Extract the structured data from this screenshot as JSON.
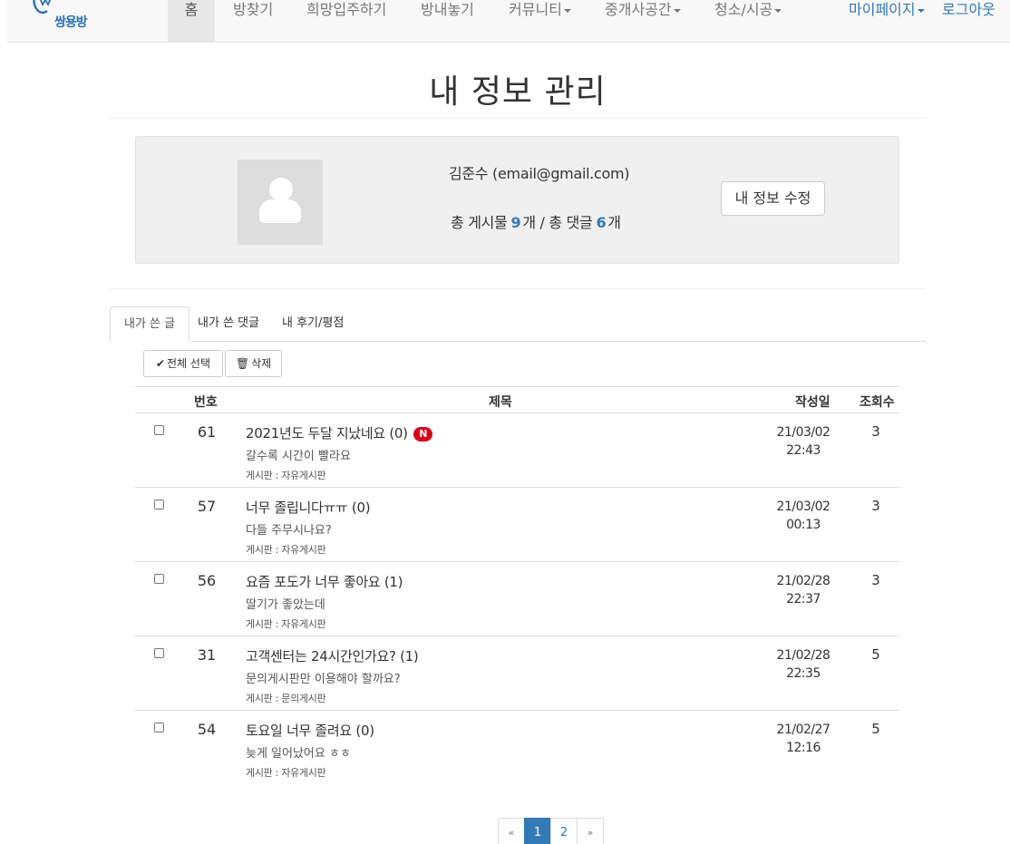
{
  "brand": {
    "name": "쌍용방"
  },
  "nav": {
    "home": "홈",
    "find_room": "방찾기",
    "wish": "희망입주하기",
    "list_room": "방내놓기",
    "community": "커뮤니티",
    "agency": "중개사공간",
    "cleaning": "청소/시공",
    "mypage": "마이페이지",
    "logout": "로그아웃"
  },
  "page": {
    "title": "내 정보 관리"
  },
  "profile": {
    "user_line": "김준수 (email@gmail.com)",
    "posts_label": "총 게시물",
    "posts_count": "9",
    "comments_label": "개 / 총 댓글",
    "comments_count": "6",
    "count_suffix": "개",
    "edit_button": "내 정보 수정"
  },
  "tabs": [
    "내가 쓴 글",
    "내가 쓴 댓글",
    "내 후기/평점"
  ],
  "actions": {
    "select_all": "전체 선택",
    "delete": "삭제"
  },
  "table": {
    "headers": {
      "no": "번호",
      "title": "제목",
      "date": "작성일",
      "views": "조회수"
    },
    "rows": [
      {
        "no": "61",
        "title": "2021년도 두달 지났네요 (0)",
        "new_badge": "N",
        "summary": "갈수록 시간이 빨라요",
        "board": "게시판 : 자유게시판",
        "date": "21/03/02",
        "time": "22:43",
        "views": "3"
      },
      {
        "no": "57",
        "title": "너무 졸립니다ㅠㅠ (0)",
        "new_badge": "",
        "summary": "다들 주무시나요?",
        "board": "게시판 : 자유게시판",
        "date": "21/03/02",
        "time": "00:13",
        "views": "3"
      },
      {
        "no": "56",
        "title": "요즘 포도가 너무 좋아요 (1)",
        "new_badge": "",
        "summary": "딸기가 좋았는데",
        "board": "게시판 : 자유게시판",
        "date": "21/02/28",
        "time": "22:37",
        "views": "3"
      },
      {
        "no": "31",
        "title": "고객센터는 24시간인가요? (1)",
        "new_badge": "",
        "summary": "문의게시판만 이용해야 할까요?",
        "board": "게시판 : 문의게시판",
        "date": "21/02/28",
        "time": "22:35",
        "views": "5"
      },
      {
        "no": "54",
        "title": "토요일 너무 졸려요 (0)",
        "new_badge": "",
        "summary": "늦게 일어났어요 ㅎㅎ",
        "board": "게시판 : 자유게시판",
        "date": "21/02/27",
        "time": "12:16",
        "views": "5"
      }
    ]
  },
  "pagination": {
    "prev": "«",
    "pages": [
      "1",
      "2"
    ],
    "next": "»",
    "current": "1"
  },
  "colors": {
    "accent": "#337ab7",
    "badge": "#d9001b"
  }
}
